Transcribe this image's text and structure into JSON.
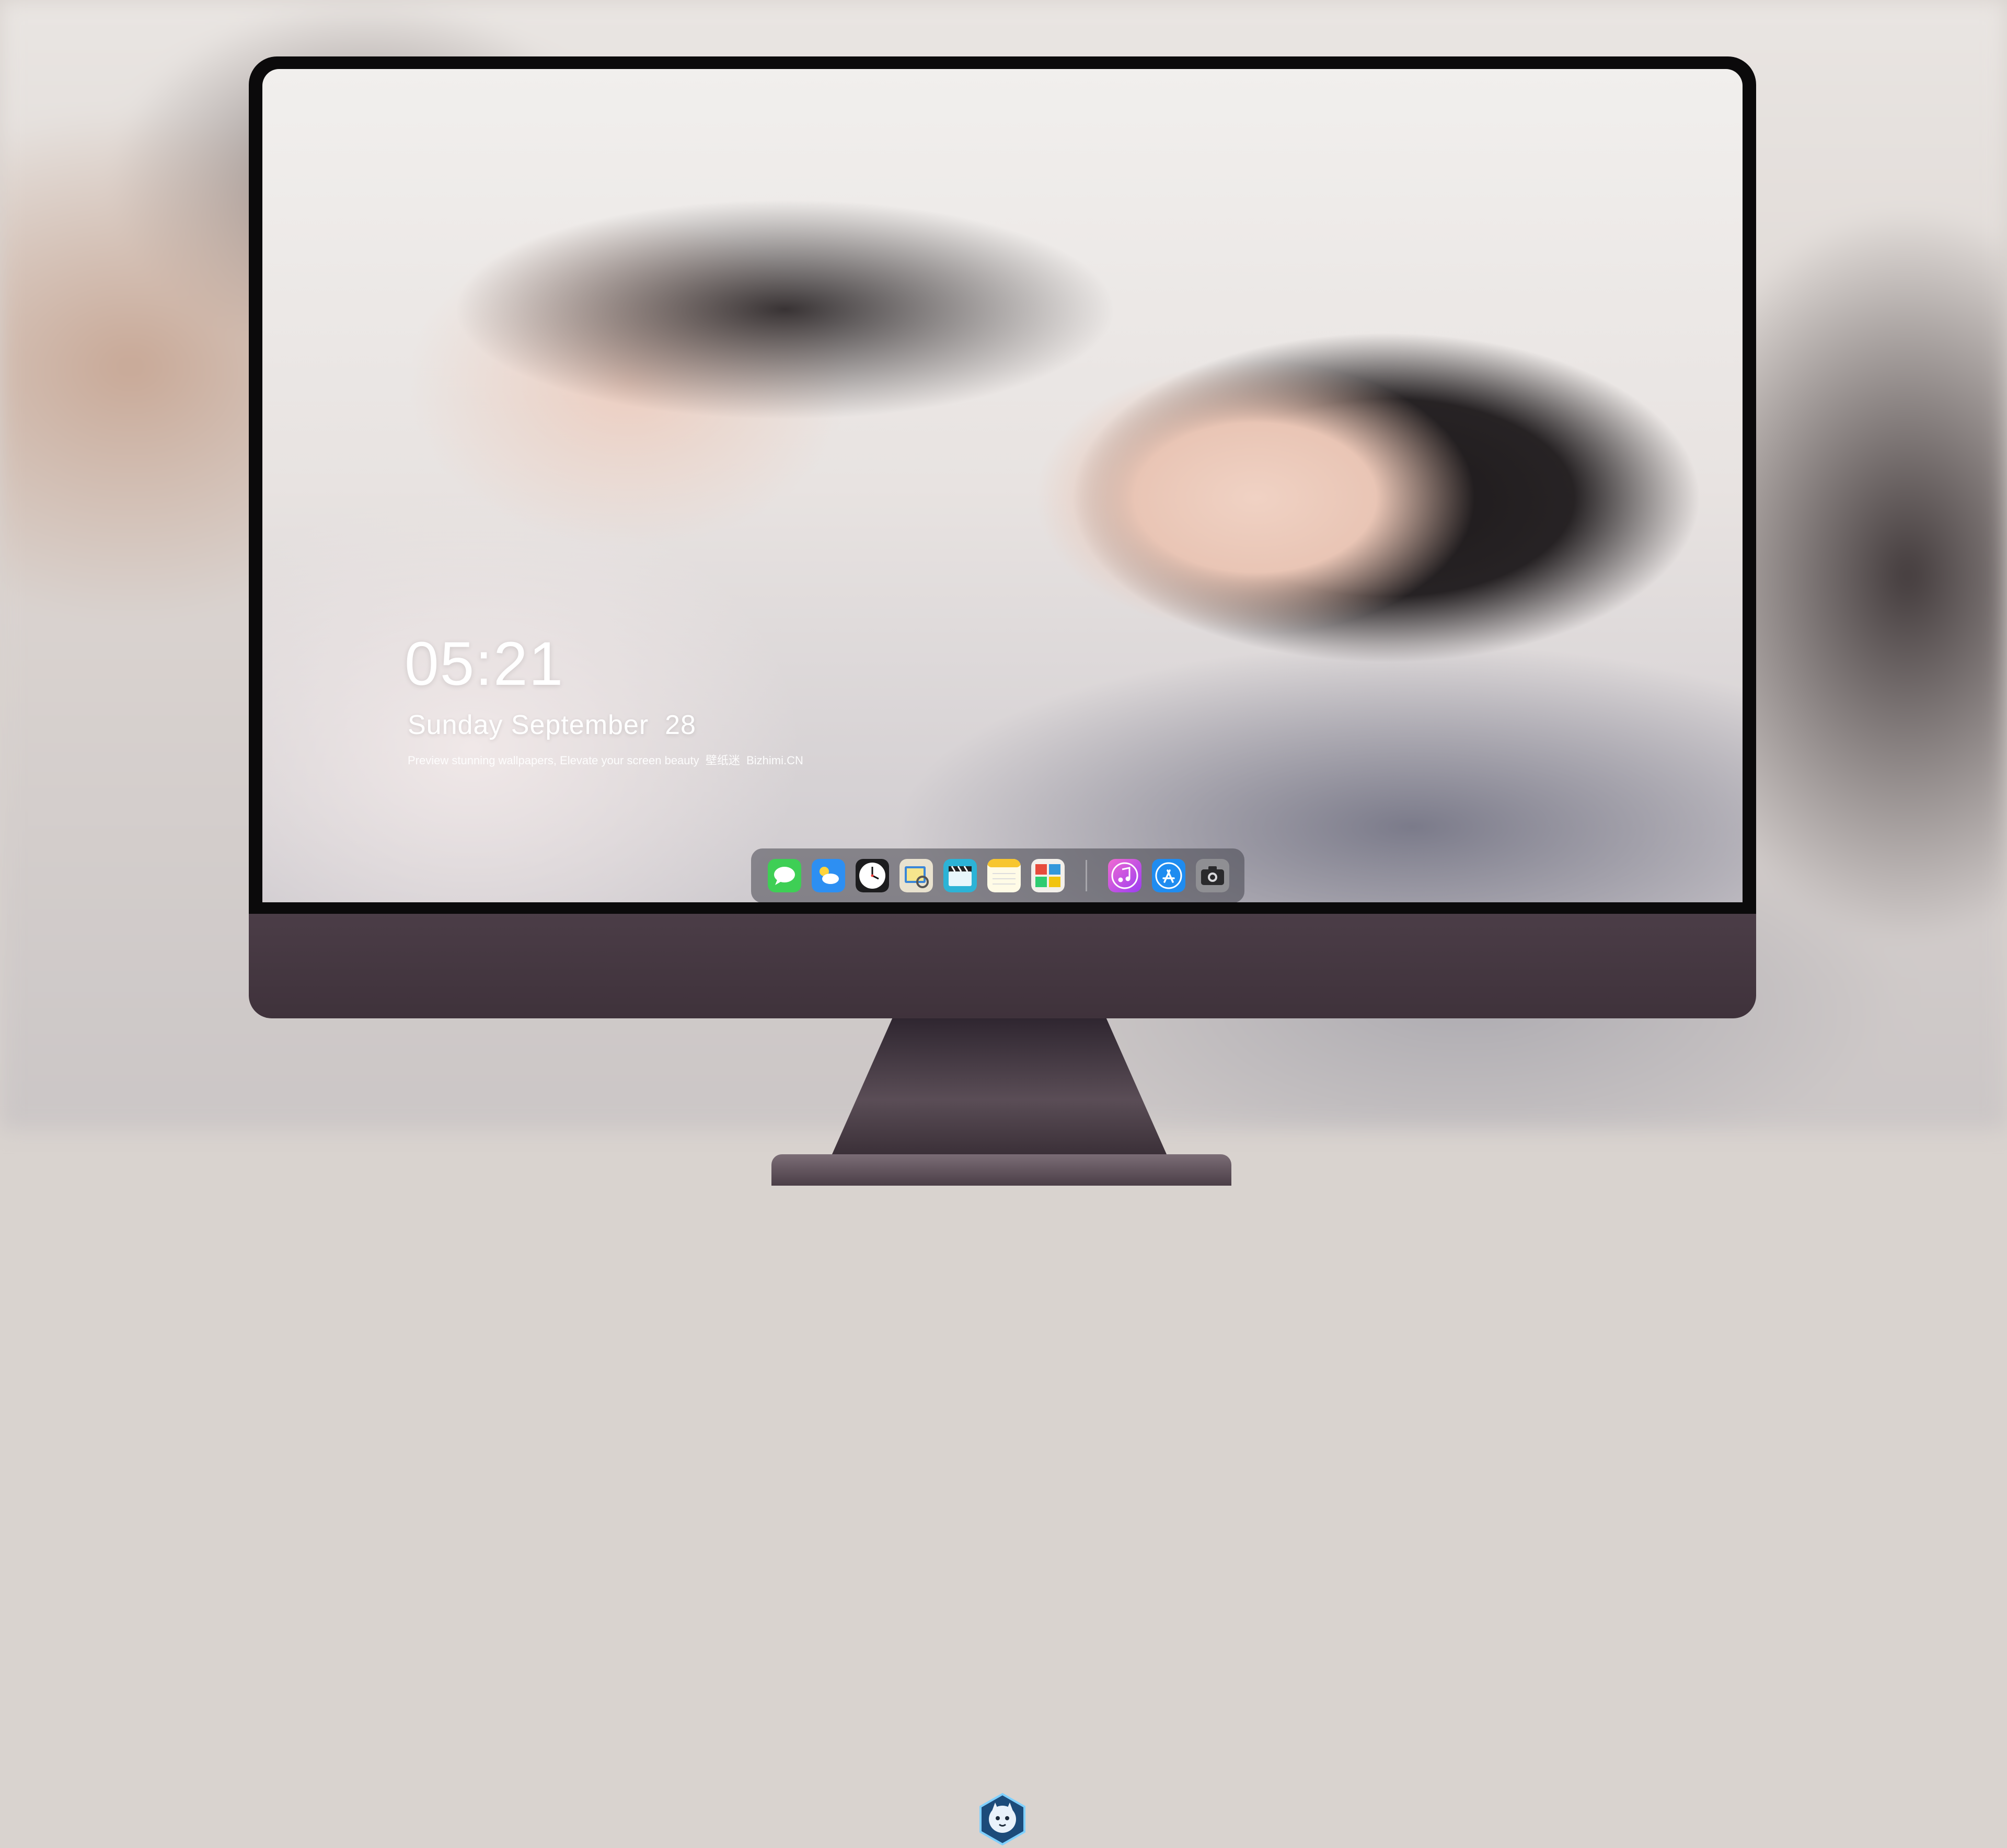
{
  "lock_screen": {
    "time": "05:21",
    "date": "Sunday September  28",
    "tagline": "Preview stunning wallpapers, Elevate your screen beauty  壁纸迷  Bizhimi.CN"
  },
  "dock": {
    "apps": [
      {
        "name": "messages",
        "icon": "messages-icon"
      },
      {
        "name": "weather",
        "icon": "weather-icon"
      },
      {
        "name": "clock",
        "icon": "clock-icon"
      },
      {
        "name": "preview",
        "icon": "preview-icon"
      },
      {
        "name": "clips",
        "icon": "clapperboard-icon"
      },
      {
        "name": "notes",
        "icon": "notes-icon"
      },
      {
        "name": "photo-booth",
        "icon": "photo-booth-icon"
      },
      {
        "name": "itunes",
        "icon": "music-icon"
      },
      {
        "name": "app-store",
        "icon": "app-store-icon"
      },
      {
        "name": "screenshot",
        "icon": "camera-icon"
      }
    ]
  },
  "colors": {
    "bezel": "#0b0a0b",
    "chin": "#4b3d47",
    "dock_background": "rgba(70,70,78,0.55)"
  }
}
